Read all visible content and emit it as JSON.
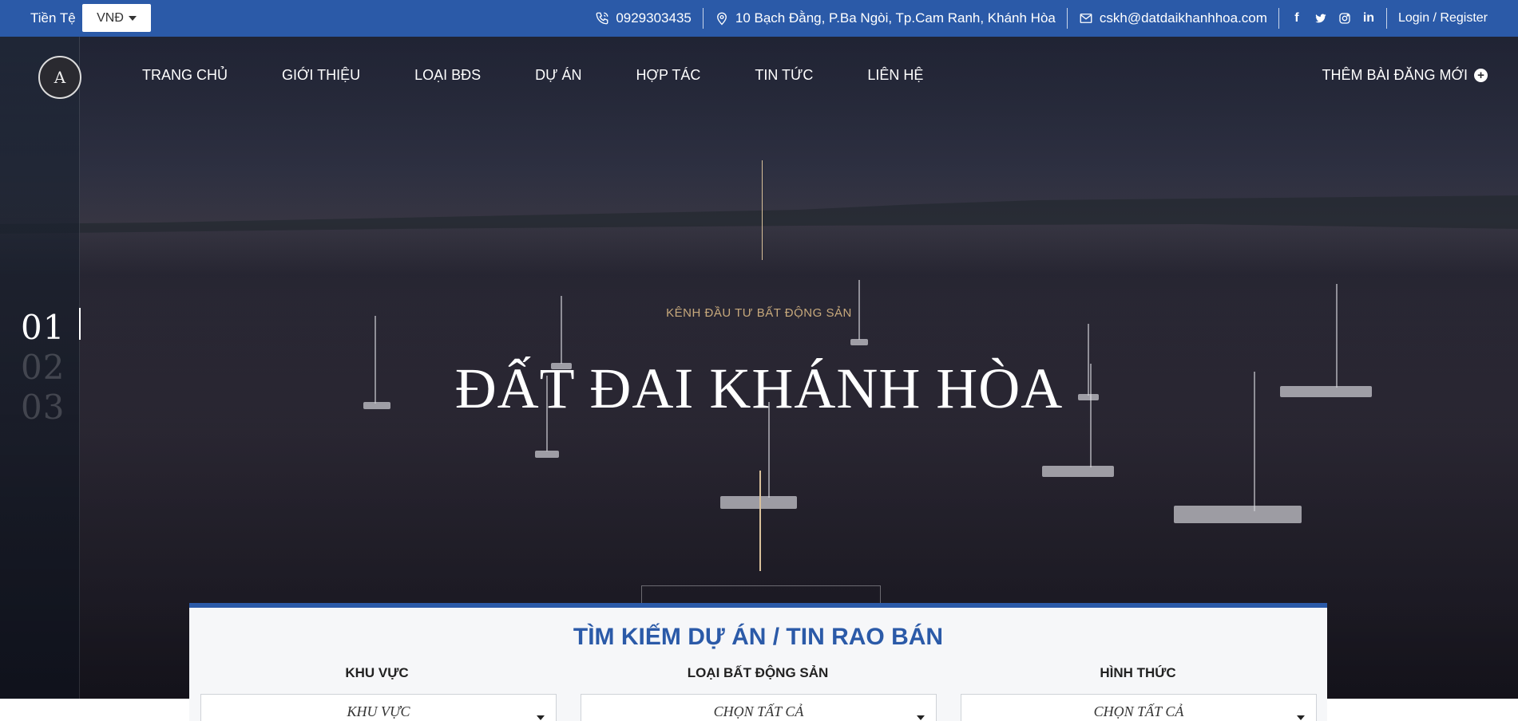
{
  "topbar": {
    "currency_label": "Tiền Tệ",
    "currency_value": "VNĐ",
    "phone": "0929303435",
    "address": "10 Bạch Đằng, P.Ba Ngòi, Tp.Cam Ranh, Khánh Hòa",
    "email": "cskh@datdaikhanhhoa.com",
    "socials": [
      "facebook-icon",
      "twitter-icon",
      "instagram-icon",
      "linkedin-icon"
    ],
    "login": "Login / Register",
    "bg_color": "#2b5aa8"
  },
  "nav": {
    "items": [
      "TRANG CHỦ",
      "GIỚI THIỆU",
      "LOẠI BĐS",
      "DỰ ÁN",
      "HỢP TÁC",
      "TIN TỨC",
      "LIÊN HỆ"
    ],
    "add_post": "THÊM BÀI ĐĂNG MỚI"
  },
  "hero": {
    "eyebrow": "KÊNH ĐẦU TƯ BẤT ĐỘNG SẢN",
    "title": "ĐẤT ĐAI KHÁNH HÒA",
    "slides": [
      "01",
      "02",
      "03"
    ],
    "active_slide": "01",
    "accent_color": "#d9c09a"
  },
  "search": {
    "title": "TÌM KIẾM DỰ ÁN / TIN RAO BÁN",
    "fields": [
      {
        "label": "KHU VỰC",
        "value": "KHU VỰC"
      },
      {
        "label": "LOẠI BẤT ĐỘNG SẢN",
        "value": "CHỌN TẤT CẢ"
      },
      {
        "label": "HÌNH THỨC",
        "value": "CHỌN TẤT CẢ"
      }
    ],
    "accent_color": "#2b5aa8"
  }
}
